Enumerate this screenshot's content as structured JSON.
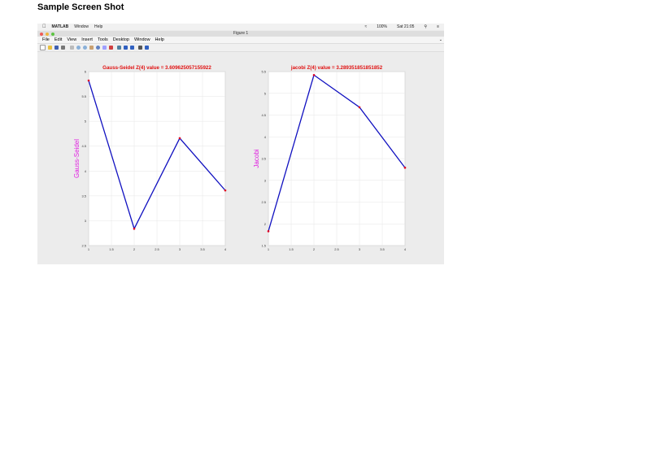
{
  "caption": "Sample Screen Shot",
  "mac_menubar": {
    "items": [
      "MATLAB",
      "Window",
      "Help"
    ],
    "status": [
      "100%",
      "Sat 21:05"
    ]
  },
  "window": {
    "title": "Figure 1"
  },
  "menu": [
    "File",
    "Edit",
    "View",
    "Insert",
    "Tools",
    "Desktop",
    "Window",
    "Help"
  ],
  "toolbar_icons": [
    "new-file-icon",
    "open-icon",
    "save-icon",
    "print-icon",
    "pointer-icon",
    "zoom-in-icon",
    "zoom-out-icon",
    "pan-icon",
    "rotate-icon",
    "data-cursor-icon",
    "brush-icon",
    "link-icon",
    "colorbar-icon",
    "legend-icon",
    "hide-plot-tools-icon",
    "show-plot-tools-icon"
  ],
  "colors": {
    "line": "#1010c0",
    "marker": "#e00020",
    "title": "#e01010",
    "ylabel": "#e020e0"
  },
  "chart_data": [
    {
      "type": "line",
      "title": "Gauss-Seidel Z(4) value = 3.609625057155922",
      "xlabel": "",
      "ylabel": "Gauss-Seidel",
      "x": [
        1,
        2,
        3,
        4
      ],
      "y": [
        5.82,
        2.84,
        4.66,
        3.61
      ],
      "xlim": [
        1,
        4
      ],
      "ylim": [
        2.5,
        6
      ],
      "xticks": [
        "1",
        "1.5",
        "2",
        "2.5",
        "3",
        "3.5",
        "4"
      ],
      "yticks": [
        "2.5",
        "3",
        "3.5",
        "4",
        "4.5",
        "5",
        "5.5",
        "6"
      ],
      "grid": true
    },
    {
      "type": "line",
      "title": "jacobi Z(4) value = 3.289351851851852",
      "xlabel": "",
      "ylabel": "Jacobi",
      "x": [
        1,
        2,
        3,
        4
      ],
      "y": [
        1.83,
        5.42,
        4.68,
        3.29
      ],
      "xlim": [
        1,
        4
      ],
      "ylim": [
        1.5,
        5.5
      ],
      "xticks": [
        "1",
        "1.5",
        "2",
        "2.5",
        "3",
        "3.5",
        "4"
      ],
      "yticks": [
        "1.5",
        "2",
        "2.5",
        "3",
        "3.5",
        "4",
        "4.5",
        "5",
        "5.5"
      ],
      "grid": true
    }
  ]
}
